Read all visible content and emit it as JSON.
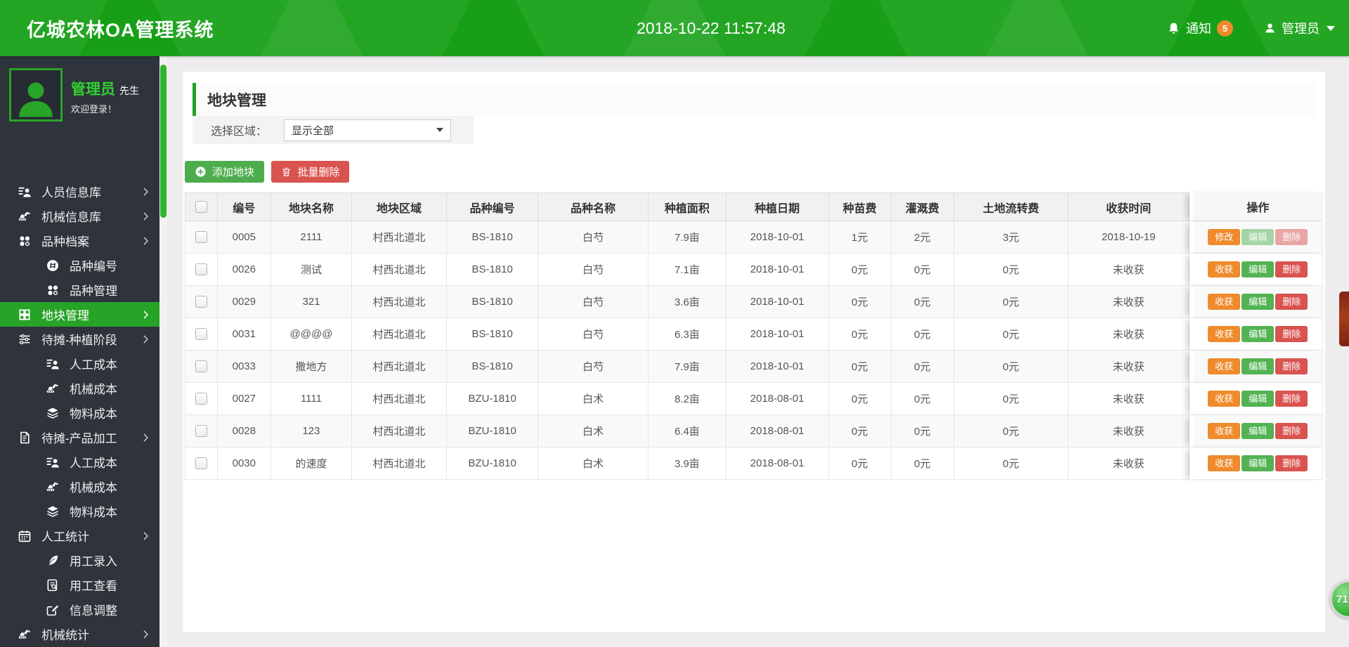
{
  "header": {
    "title": "亿城农林OA管理系统",
    "datetime": "2018-10-22 11:57:48",
    "notice_label": "通知",
    "notice_count": "5",
    "user_label": "管理员"
  },
  "sidebar": {
    "profile": {
      "name": "管理员",
      "suffix": "先生",
      "welcome": "欢迎登录！"
    },
    "menu": [
      {
        "name": "sidebar-item-personnel-db",
        "label": "人员信息库",
        "icon": "people-list-icon",
        "level": 1,
        "chevron": true
      },
      {
        "name": "sidebar-item-machine-db",
        "label": "机械信息库",
        "icon": "machine-icon",
        "level": 1,
        "chevron": true
      },
      {
        "name": "sidebar-item-variety-archive",
        "label": "品种档案",
        "icon": "variety-icon",
        "level": 1,
        "chevron": true
      },
      {
        "name": "sidebar-item-variety-number",
        "label": "品种编号",
        "icon": "number-icon",
        "level": 2
      },
      {
        "name": "sidebar-item-variety-management",
        "label": "品种管理",
        "icon": "variety-icon",
        "level": 2
      },
      {
        "name": "sidebar-item-plot-management",
        "label": "地块管理",
        "icon": "plot-icon",
        "level": 1,
        "chevron": true,
        "active": true
      },
      {
        "name": "sidebar-item-pending-planting-stage",
        "label": "待摊-种植阶段",
        "icon": "sliders-icon",
        "level": 1,
        "chevron": true
      },
      {
        "name": "sidebar-item-planting-labor-cost",
        "label": "人工成本",
        "icon": "people-list-icon",
        "level": 2
      },
      {
        "name": "sidebar-item-planting-machine-cost",
        "label": "机械成本",
        "icon": "machine-icon",
        "level": 2
      },
      {
        "name": "sidebar-item-planting-material-cost",
        "label": "物料成本",
        "icon": "layers-icon",
        "level": 2
      },
      {
        "name": "sidebar-item-pending-product-processing",
        "label": "待摊-产品加工",
        "icon": "process-icon",
        "level": 1,
        "chevron": true
      },
      {
        "name": "sidebar-item-processing-labor-cost",
        "label": "人工成本",
        "icon": "people-list-icon",
        "level": 2
      },
      {
        "name": "sidebar-item-processing-machine-cost",
        "label": "机械成本",
        "icon": "machine-icon",
        "level": 2
      },
      {
        "name": "sidebar-item-processing-material-cost",
        "label": "物料成本",
        "icon": "layers-icon",
        "level": 2
      },
      {
        "name": "sidebar-item-labor-statistics",
        "label": "人工统计",
        "icon": "calendar-icon",
        "level": 1,
        "chevron": true
      },
      {
        "name": "sidebar-item-labor-entry",
        "label": "用工录入",
        "icon": "pen-icon",
        "level": 2
      },
      {
        "name": "sidebar-item-labor-view",
        "label": "用工查看",
        "icon": "doc-search-icon",
        "level": 2
      },
      {
        "name": "sidebar-item-info-adjust",
        "label": "信息调整",
        "icon": "edit-icon",
        "level": 2
      },
      {
        "name": "sidebar-item-machine-statistics",
        "label": "机械统计",
        "icon": "machine-icon",
        "level": 1,
        "chevron": true
      }
    ]
  },
  "main": {
    "panel_title": "地块管理",
    "filter_label": "选择区域：",
    "filter_value": "显示全部",
    "add_button": "添加地块",
    "bulk_delete_button": "批量删除",
    "table": {
      "columns": [
        {
          "key": "id",
          "label": "编号"
        },
        {
          "key": "name",
          "label": "地块名称"
        },
        {
          "key": "region",
          "label": "地块区域"
        },
        {
          "key": "variety-no",
          "label": "品种编号"
        },
        {
          "key": "variety-name",
          "label": "品种名称"
        },
        {
          "key": "area",
          "label": "种植面积"
        },
        {
          "key": "plant-date",
          "label": "种植日期"
        },
        {
          "key": "seed-fee",
          "label": "种苗费"
        },
        {
          "key": "irrigation-fee",
          "label": "灌溉费"
        },
        {
          "key": "land-transfer-fee",
          "label": "土地流转费"
        },
        {
          "key": "harvest-time",
          "label": "收获时间"
        },
        {
          "key": "actions",
          "label": "操作"
        }
      ],
      "rows": [
        {
          "cells": [
            "0005",
            "2111",
            "村西北道北",
            "BS-1810",
            "白芍",
            "7.9亩",
            "2018-10-01",
            "1元",
            "2元",
            "3元",
            "2018-10-19"
          ],
          "actions": [
            {
              "label": "修改",
              "variant": "orange",
              "muted": false
            },
            {
              "label": "编辑",
              "variant": "green",
              "muted": true
            },
            {
              "label": "删除",
              "variant": "red",
              "muted": true
            }
          ]
        },
        {
          "cells": [
            "0026",
            "测试",
            "村西北道北",
            "BS-1810",
            "白芍",
            "7.1亩",
            "2018-10-01",
            "0元",
            "0元",
            "0元",
            "未收获"
          ],
          "actions": [
            {
              "label": "收获",
              "variant": "orange",
              "muted": false
            },
            {
              "label": "编辑",
              "variant": "green",
              "muted": false
            },
            {
              "label": "删除",
              "variant": "red",
              "muted": false
            }
          ]
        },
        {
          "cells": [
            "0029",
            "321",
            "村西北道北",
            "BS-1810",
            "白芍",
            "3.6亩",
            "2018-10-01",
            "0元",
            "0元",
            "0元",
            "未收获"
          ],
          "actions": [
            {
              "label": "收获",
              "variant": "orange",
              "muted": false
            },
            {
              "label": "编辑",
              "variant": "green",
              "muted": false
            },
            {
              "label": "删除",
              "variant": "red",
              "muted": false
            }
          ]
        },
        {
          "cells": [
            "0031",
            "@@@@",
            "村西北道北",
            "BS-1810",
            "白芍",
            "6.3亩",
            "2018-10-01",
            "0元",
            "0元",
            "0元",
            "未收获"
          ],
          "actions": [
            {
              "label": "收获",
              "variant": "orange",
              "muted": false
            },
            {
              "label": "编辑",
              "variant": "green",
              "muted": false
            },
            {
              "label": "删除",
              "variant": "red",
              "muted": false
            }
          ]
        },
        {
          "cells": [
            "0033",
            "撒地方",
            "村西北道北",
            "BS-1810",
            "白芍",
            "7.9亩",
            "2018-10-01",
            "0元",
            "0元",
            "0元",
            "未收获"
          ],
          "actions": [
            {
              "label": "收获",
              "variant": "orange",
              "muted": false
            },
            {
              "label": "编辑",
              "variant": "green",
              "muted": false
            },
            {
              "label": "删除",
              "variant": "red",
              "muted": false
            }
          ]
        },
        {
          "cells": [
            "0027",
            "1111",
            "村西北道北",
            "BZU-1810",
            "白术",
            "8.2亩",
            "2018-08-01",
            "0元",
            "0元",
            "0元",
            "未收获"
          ],
          "actions": [
            {
              "label": "收获",
              "variant": "orange",
              "muted": false
            },
            {
              "label": "编辑",
              "variant": "green",
              "muted": false
            },
            {
              "label": "删除",
              "variant": "red",
              "muted": false
            }
          ]
        },
        {
          "cells": [
            "0028",
            "123",
            "村西北道北",
            "BZU-1810",
            "白术",
            "6.4亩",
            "2018-08-01",
            "0元",
            "0元",
            "0元",
            "未收获"
          ],
          "actions": [
            {
              "label": "收获",
              "variant": "orange",
              "muted": false
            },
            {
              "label": "编辑",
              "variant": "green",
              "muted": false
            },
            {
              "label": "删除",
              "variant": "red",
              "muted": false
            }
          ]
        },
        {
          "cells": [
            "0030",
            "的速度",
            "村西北道北",
            "BZU-1810",
            "白术",
            "3.9亩",
            "2018-08-01",
            "0元",
            "0元",
            "0元",
            "未收获"
          ],
          "actions": [
            {
              "label": "收获",
              "variant": "orange",
              "muted": false
            },
            {
              "label": "编辑",
              "variant": "green",
              "muted": false
            },
            {
              "label": "删除",
              "variant": "red",
              "muted": false
            }
          ]
        }
      ]
    }
  },
  "floating": {
    "qq_badge": "71"
  },
  "colors": {
    "brand_green": "#17a017",
    "active_green": "#27a327",
    "sidebar_dark": "#2f333b",
    "orange": "#ef8b2d",
    "action_green": "#53b353",
    "action_red": "#d9534f",
    "badge_orange": "#ef8a2c"
  }
}
